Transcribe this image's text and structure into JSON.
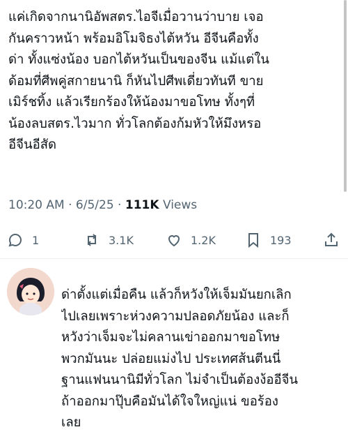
{
  "tweet": {
    "lines": [
      "แค่เกิดจากนานิอัพสตร.ไอจีเมื่อวานว่าบาย เจอ",
      "กันคราวหน้า พร้อมอิโมจิธงไต้หวัน อีจีนคือทั้ง",
      "ด่า ทั้งแซ่งน้อง บอกไต้หวันเป็นของจีน แม้แต่ใน",
      "ด้อมที่ศีพคู่สกายนานิ ก็หันไปศีพเดี่ยวทันที ขาย",
      "เมิร์ชทิ้ง แล้วเรียกร้องให้น้องมาขอโทษ ทั้งๆที่",
      "น้องลบสตร.ไวมาก ทั่วโลกต้องก้มหัวให้มึงหรอ",
      "อีจีนอีสัด"
    ],
    "time": "10:20 AM",
    "dot": "·",
    "date": "6/5/25",
    "views_count": "111K",
    "views_label": "Views"
  },
  "actions": {
    "reply_count": "1",
    "retweet_count": "3.1K",
    "like_count": "1.2K",
    "bookmark_count": "193"
  },
  "reply": {
    "lines": [
      "ด่าตั้งแต่เมื่อคืน แล้วก็หวังให้เจ็มมันยกเลิก",
      "ไปเลยเพราะห่วงความปลอดภัยน้อง และก็",
      "หวังว่าเจ็มจะไม่คลานเข่าออกมาขอโทษ",
      "พวกมันนะ ปล่อยแม่งไป ประเทศส้นตีนนี่",
      "ฐานแฟนนานิมีทั่วโลก ไม่จำเป็นต้องง้ออีจีน",
      "ถ้าออกมาปุ๊บคือมันได้ใจใหญ่แน่ ขอร้อง",
      "เลย"
    ]
  },
  "colors": {
    "text": "#0f1419",
    "muted": "#536471",
    "divider": "#eff3f4"
  },
  "icons": [
    "reply-icon",
    "retweet-icon",
    "like-icon",
    "bookmark-icon",
    "share-icon"
  ]
}
